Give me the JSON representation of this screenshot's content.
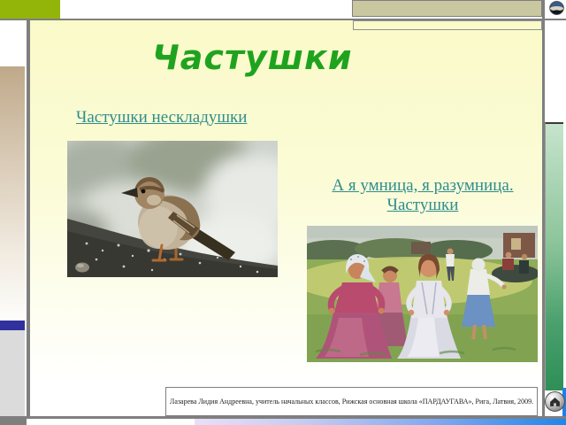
{
  "slide": {
    "title": "Частушки",
    "hyperlinks": {
      "neskladushki": {
        "label": "Частушки нескладушки"
      },
      "umnitsa": {
        "line1": "А я умница, я разумница. ",
        "line2": "Частушки"
      }
    },
    "credit": "Лазарева Лидия Андреевна,  учитель начальных классов,  Рижская основная школа «ПАРДАУГАВА»,  Рига, Латвия, 2009.",
    "images": {
      "sparrow": "sparrow-photo",
      "painting": "dancing-women-painting"
    }
  },
  "icons": {
    "home": "home-icon",
    "globe": "globe-icon"
  },
  "colors": {
    "title_green": "#1FA31F",
    "hyperlink_teal": "#2E8D8D",
    "slide_background_top": "#FAFAC9",
    "olive_accent": "#93B50A",
    "light_green_accent": "#BCD96A",
    "tan_accent": "#C9C7A0",
    "navy_accent": "#31319E",
    "right_bar_green": "#2E8F57",
    "bottom_bar_blue": "#1E86EC"
  }
}
